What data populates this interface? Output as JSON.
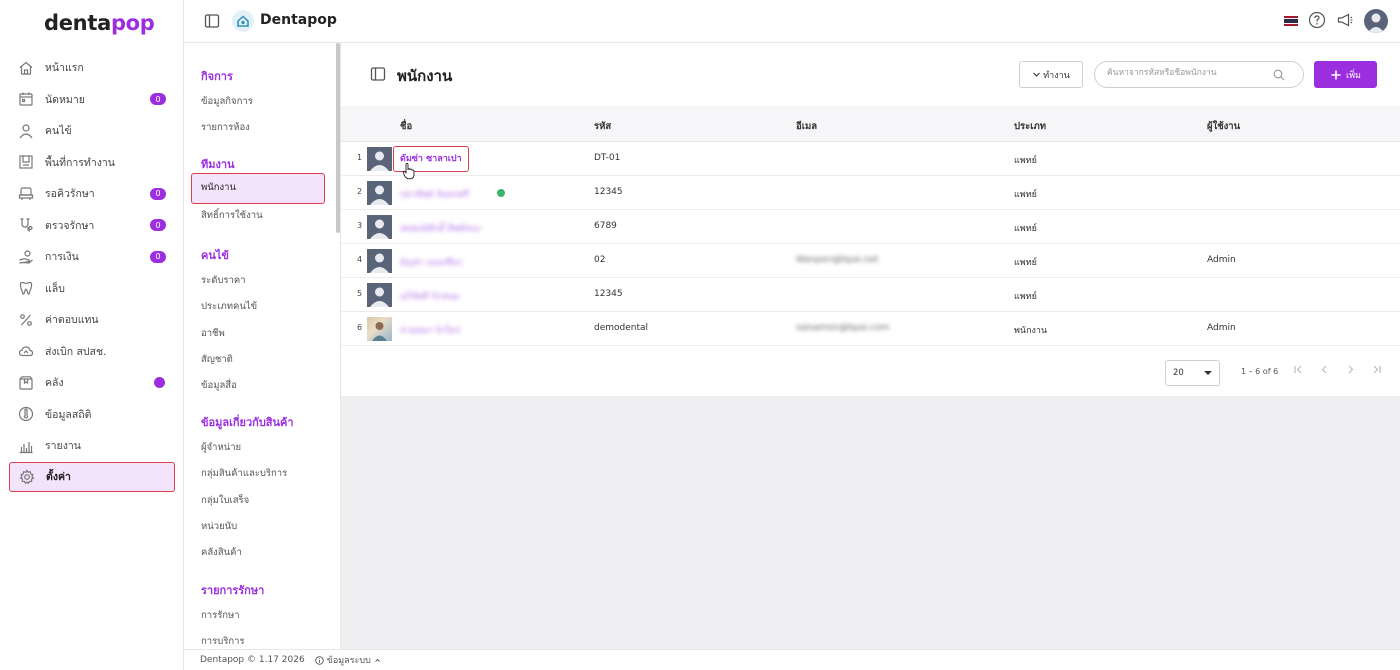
{
  "brand": {
    "part1": "denta",
    "part2": "pop"
  },
  "topbar": {
    "app_title": "Dentapop"
  },
  "colors": {
    "accent": "#9b2fe0",
    "highlight_border": "#d9404b",
    "highlight_bg": "#f3e4fb"
  },
  "nav": {
    "items": [
      {
        "label": "หน้าแรก",
        "icon": "home-icon",
        "badge": ""
      },
      {
        "label": "นัดหมาย",
        "icon": "calendar-icon",
        "badge": "0"
      },
      {
        "label": "คนไข้",
        "icon": "user-icon",
        "badge": ""
      },
      {
        "label": "พื้นที่การทำงาน",
        "icon": "workspace-icon",
        "badge": ""
      },
      {
        "label": "รอคิวรักษา",
        "icon": "queue-chair-icon",
        "badge": "0"
      },
      {
        "label": "ตรวจรักษา",
        "icon": "treatment-icon",
        "badge": "0"
      },
      {
        "label": "การเงิน",
        "icon": "finance-icon",
        "badge": "0"
      },
      {
        "label": "แล็บ",
        "icon": "tooth-icon",
        "badge": ""
      },
      {
        "label": "ค่าตอบแทน",
        "icon": "percent-icon",
        "badge": ""
      },
      {
        "label": "ส่งเบิก สปสช.",
        "icon": "cloud-icon",
        "badge": ""
      },
      {
        "label": "คลัง",
        "icon": "box-icon",
        "badge": ""
      },
      {
        "label": "ข้อมูลสถิติ",
        "icon": "thermometer-icon",
        "badge": ""
      },
      {
        "label": "รายงาน",
        "icon": "bar-chart-icon",
        "badge": ""
      },
      {
        "label": "ตั้งค่า",
        "icon": "gear-icon",
        "badge": ""
      }
    ]
  },
  "subnav": {
    "sections": [
      {
        "title": "กิจการ",
        "items": [
          "ข้อมูลกิจการ",
          "รายการห้อง"
        ]
      },
      {
        "title": "ทีมงาน",
        "items": [
          "พนักงาน",
          "สิทธิ์การใช้งาน"
        ]
      },
      {
        "title": "คนไข้",
        "items": [
          "ระดับราคา",
          "ประเภทคนไข้",
          "อาชีพ",
          "สัญชาติ",
          "ข้อมูลสื่อ"
        ]
      },
      {
        "title": "ข้อมูลเกี่ยวกับสินค้า",
        "items": [
          "ผู้จำหน่าย",
          "กลุ่มสินค้าและบริการ",
          "กลุ่มใบเสร็จ",
          "หน่วยนับ",
          "คลังสินค้า"
        ]
      },
      {
        "title": "รายการรักษา",
        "items": [
          "การรักษา",
          "การบริการ"
        ]
      }
    ]
  },
  "page": {
    "title": "พนักงาน",
    "status_button": "ทำงาน",
    "search_placeholder": "ค้นหาจากรหัสหรือชื่อพนักงาน",
    "add_button": "เพิ่ม"
  },
  "table": {
    "headers": {
      "name": "ชื่อ",
      "code": "รหัส",
      "email": "อีเมล",
      "type": "ประเภท",
      "user": "ผู้ใช้งาน"
    },
    "rows": [
      {
        "num": "1",
        "name": "ดัมซ่า ซาลาเปา",
        "code": "DT-01",
        "email": "",
        "type": "แพทย์",
        "user": ""
      },
      {
        "num": "2",
        "name": "ปลาทิพย์ จันทรศรี",
        "code": "12345",
        "email": "",
        "type": "แพทย์",
        "user": ""
      },
      {
        "num": "3",
        "name": "สมพงษ์ศักดิ์ ทิพย์ทอง",
        "code": "6789",
        "email": "",
        "type": "แพทย์",
        "user": ""
      },
      {
        "num": "4",
        "name": "ธัญช่า มณเฑียร",
        "code": "02",
        "email": "Wanpen@bpai.net",
        "type": "แพทย์",
        "user": "Admin"
      },
      {
        "num": "5",
        "name": "อภิชัยดี รักสนม",
        "code": "12345",
        "email": "",
        "type": "แพทย์",
        "user": ""
      },
      {
        "num": "6",
        "name": "สายสมร รักใคร่",
        "code": "demodental",
        "email": "saisamon@bpai.com",
        "type": "พนักงาน",
        "user": "Admin"
      }
    ]
  },
  "pagination": {
    "page_size": "20",
    "range": "1 – 6 of 6"
  },
  "footer": {
    "copyright": "Dentapop © 1.17 2026",
    "system_info": "ข้อมูลระบบ"
  }
}
